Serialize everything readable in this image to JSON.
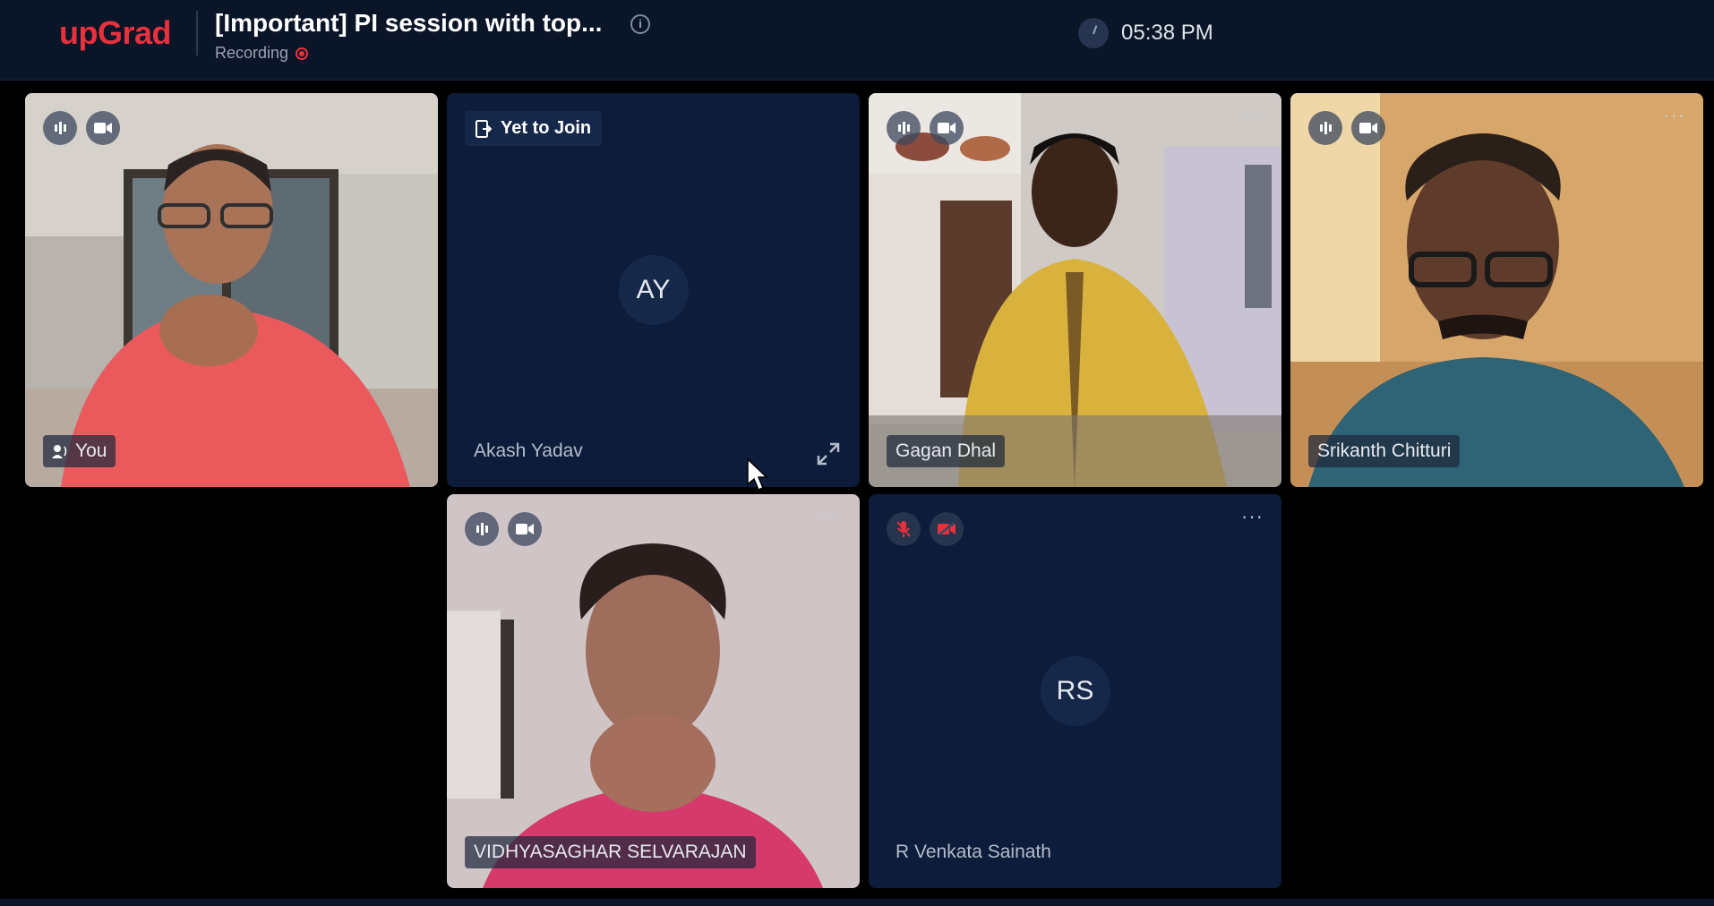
{
  "header": {
    "logo": "upGrad",
    "title": "[Important] PI session with top...",
    "info_icon": "info-icon",
    "status": "Recording",
    "time": "05:38 PM"
  },
  "tiles": [
    {
      "name": "You",
      "state": "video",
      "audio": "on",
      "video": "on"
    },
    {
      "name": "Akash Yadav",
      "state": "avatar",
      "initials": "AY",
      "badge": "Yet to Join"
    },
    {
      "name": "Gagan Dhal",
      "state": "video",
      "audio": "on",
      "video": "on"
    },
    {
      "name": "Srikanth Chitturi",
      "state": "video",
      "audio": "on",
      "video": "on"
    },
    {
      "name": "VIDHYASAGHAR SELVARAJAN",
      "state": "video",
      "audio": "on",
      "video": "on"
    },
    {
      "name": "R Venkata Sainath",
      "state": "avatar",
      "initials": "RS",
      "audio": "muted",
      "video": "off"
    }
  ],
  "colors": {
    "brand": "#e8313c",
    "header_bg": "#0b1528",
    "tile_bg": "#0d1c3a",
    "page_bg": "#000000"
  }
}
